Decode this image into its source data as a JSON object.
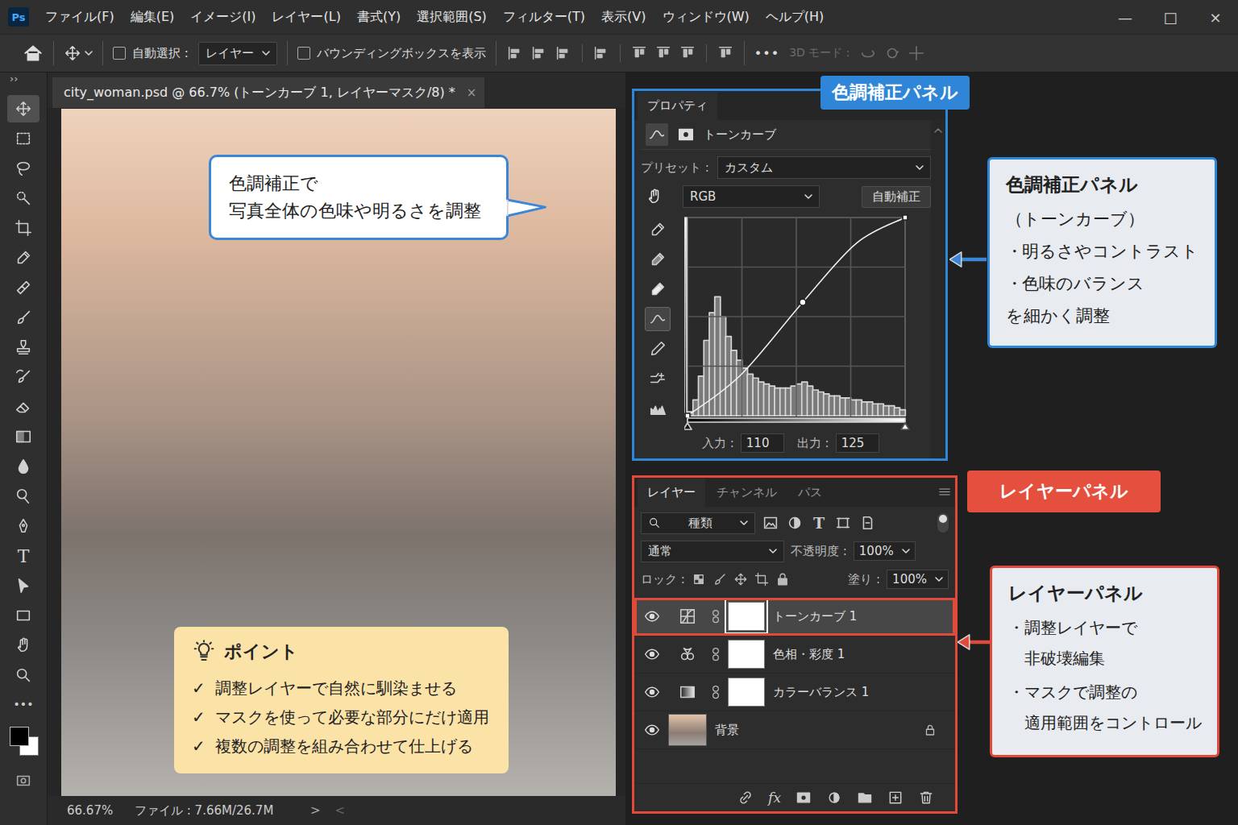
{
  "app": {
    "logo": "Ps",
    "menus": [
      "ファイル(F)",
      "編集(E)",
      "イメージ(I)",
      "レイヤー(L)",
      "書式(Y)",
      "選択範囲(S)",
      "フィルター(T)",
      "表示(V)",
      "ウィンドウ(W)",
      "ヘルプ(H)"
    ],
    "window_controls": [
      "—",
      "□",
      "×"
    ]
  },
  "options_bar": {
    "auto_select": {
      "label": "自動選択 :",
      "checked": false
    },
    "target": {
      "value": "レイヤー"
    },
    "bounding_box": {
      "label": "バウンディングボックスを表示",
      "checked": false
    },
    "more": "•••",
    "mode_3d": {
      "label": "3D モード :",
      "disabled": true
    }
  },
  "toolbar": {
    "expand": "››",
    "type_glyph": "T",
    "tools": [
      {
        "selected": true
      },
      {
        "selected": false
      },
      {
        "selected": false
      },
      {
        "selected": false
      },
      {
        "selected": false
      },
      {
        "selected": false
      },
      {
        "selected": false
      },
      {
        "selected": false
      },
      {
        "selected": false
      },
      {
        "selected": false
      },
      {
        "selected": false
      },
      {
        "selected": false
      },
      {
        "selected": false
      },
      {
        "selected": false
      },
      {
        "selected": false
      },
      {
        "selected": false
      },
      {
        "selected": false
      },
      {
        "selected": false
      },
      {
        "selected": false
      },
      {
        "selected": false
      }
    ],
    "more": "•••"
  },
  "document": {
    "tab": {
      "title": "city_woman.psd @ 66.7% (トーンカーブ 1, レイヤーマスク/8) *",
      "close": "×",
      "selected": true
    },
    "callout": {
      "lines": [
        "色調補正で",
        "写真全体の色味や明るさを調整"
      ]
    },
    "tips": {
      "title": "ポイント",
      "check": "✓",
      "items": [
        "調整レイヤーで自然に馴染ませる",
        "マスクを使って必要な部分にだけ適用",
        "複数の調整を組み合わせて仕上げる"
      ]
    }
  },
  "status_bar": {
    "zoom": "66.67%",
    "file": "ファイル : 7.66M/26.7M",
    "next": ">",
    "prev": "<"
  },
  "properties": {
    "tab": "プロパティ",
    "type": "トーンカーブ",
    "preset_label": "プリセット :",
    "preset": "カスタム",
    "channel": "RGB",
    "auto_button": "自動補正",
    "tools": [
      {
        "selected": false
      },
      {
        "selected": false
      },
      {
        "selected": false
      },
      {
        "selected": true
      },
      {
        "selected": false
      },
      {
        "selected": false
      },
      {
        "selected": false
      }
    ],
    "curve": {
      "points": [
        {
          "in": 0,
          "out": 0,
          "kind": "end"
        },
        {
          "in": 62,
          "out": 52,
          "kind": "guide"
        },
        {
          "in": 135,
          "out": 146,
          "kind": "anchor"
        },
        {
          "in": 198,
          "out": 222,
          "kind": "guide"
        },
        {
          "in": 255,
          "out": 255,
          "kind": "end"
        }
      ]
    },
    "histogram": [
      0.02,
      0.08,
      0.2,
      0.38,
      0.52,
      0.6,
      0.5,
      0.4,
      0.33,
      0.28,
      0.24,
      0.21,
      0.19,
      0.17,
      0.16,
      0.15,
      0.14,
      0.14,
      0.14,
      0.15,
      0.16,
      0.17,
      0.15,
      0.13,
      0.12,
      0.11,
      0.1,
      0.1,
      0.09,
      0.09,
      0.08,
      0.08,
      0.07,
      0.07,
      0.06,
      0.06,
      0.05,
      0.05,
      0.04,
      0.03
    ],
    "input_label": "入力 :",
    "input": "110",
    "output_label": "出力 :",
    "output": "125"
  },
  "layers_panel": {
    "tabs": [
      {
        "label": "レイヤー",
        "selected": true
      },
      {
        "label": "チャンネル",
        "selected": false
      },
      {
        "label": "パス",
        "selected": false
      }
    ],
    "filter": "種類",
    "type_glyph": "T",
    "blend_mode": "通常",
    "opacity_label": "不透明度 :",
    "opacity": "100%",
    "lock_label": "ロック :",
    "fill_label": "塗り :",
    "fill": "100%",
    "layers": [
      {
        "name": "トーンカーブ 1",
        "kind": "curves",
        "visible": true,
        "selected": true,
        "locked": false,
        "has_mask": true
      },
      {
        "name": "色相・彩度 1",
        "kind": "huesat",
        "visible": true,
        "selected": false,
        "locked": false,
        "has_mask": true
      },
      {
        "name": "カラーバランス 1",
        "kind": "balance",
        "visible": true,
        "selected": false,
        "locked": false,
        "has_mask": true
      },
      {
        "name": "背景",
        "kind": "image",
        "visible": true,
        "selected": false,
        "locked": true,
        "has_mask": false
      }
    ],
    "footer_fx": "fx"
  },
  "annotations": {
    "properties": {
      "tag": "色調補正パネル",
      "title": "色調補正パネル",
      "subtitle": "（トーンカーブ）",
      "bullet": "・",
      "items": [
        {
          "lines": [
            "明るさやコントラスト"
          ]
        },
        {
          "lines": [
            "色味のバランス"
          ]
        }
      ],
      "footer": "を細かく調整"
    },
    "layers": {
      "tag": "レイヤーパネル",
      "title": "レイヤーパネル",
      "bullet": "・",
      "items": [
        {
          "lines": [
            "調整レイヤーで",
            "非破壊編集"
          ]
        },
        {
          "lines": [
            "マスクで調整の",
            "適用範囲をコントロール"
          ]
        }
      ]
    }
  }
}
